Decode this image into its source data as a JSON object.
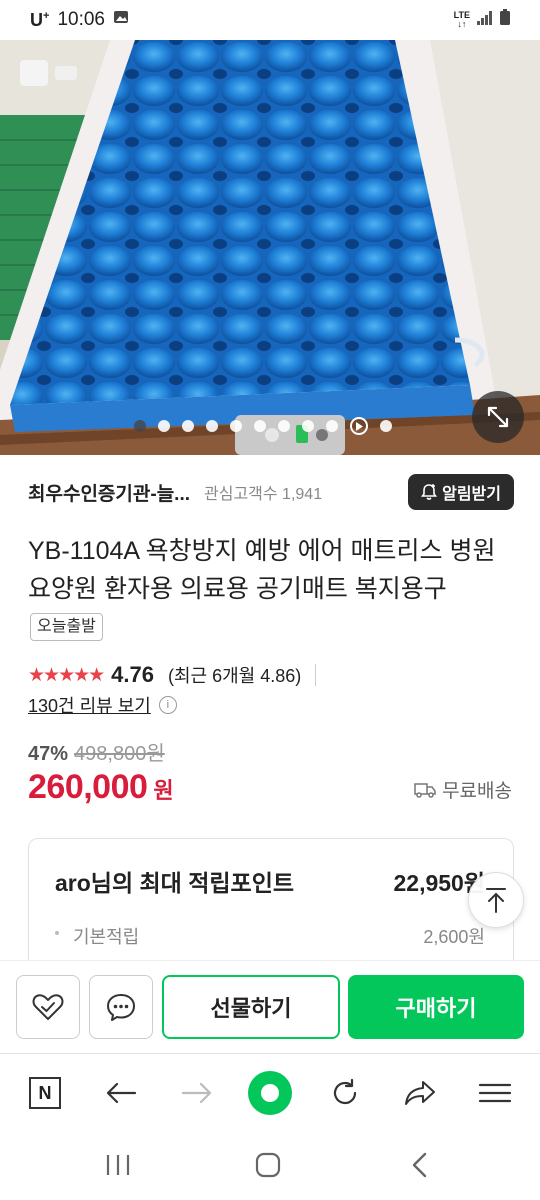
{
  "status_bar": {
    "carrier": "U",
    "carrier_sup": "+",
    "time": "10:06",
    "network": "LTE",
    "icons": [
      "gallery-icon",
      "signal-icon",
      "battery-icon"
    ]
  },
  "hero": {
    "image_description": "product-photo-blue-air-mattress",
    "carousel": {
      "dot_count": 10,
      "active_index": 0,
      "has_play_button": true
    }
  },
  "seller": {
    "name": "최우수인증기관-늘...",
    "followers_label": "관심고객수 1,941",
    "alarm_label": "알림받기"
  },
  "product": {
    "title": "YB-1104A 욕창방지 예방 에어 매트리스 병원 요양원 환자용 의료용 공기매트 복지용구",
    "badge": "오늘출발"
  },
  "rating": {
    "stars": "★★★★★",
    "value": "4.76",
    "recent": "(최근 6개월 4.86)",
    "reviews_label": "130건 리뷰 보기",
    "info_icon": "i"
  },
  "price": {
    "discount_rate": "47%",
    "original": "498,800원",
    "sale": "260,000",
    "unit": "원",
    "shipping": "무료배송"
  },
  "points": {
    "title": "aro님의 최대 적립포인트",
    "total": "22,950원",
    "base_label": "기본적립",
    "base_value": "2,600원"
  },
  "actions": {
    "gift_label": "선물하기",
    "buy_label": "구매하기"
  },
  "browser": {
    "home_label": "N"
  },
  "colors": {
    "accent_green": "#03c75a",
    "price_red": "#d91b3c",
    "star_red": "#e8434b"
  }
}
